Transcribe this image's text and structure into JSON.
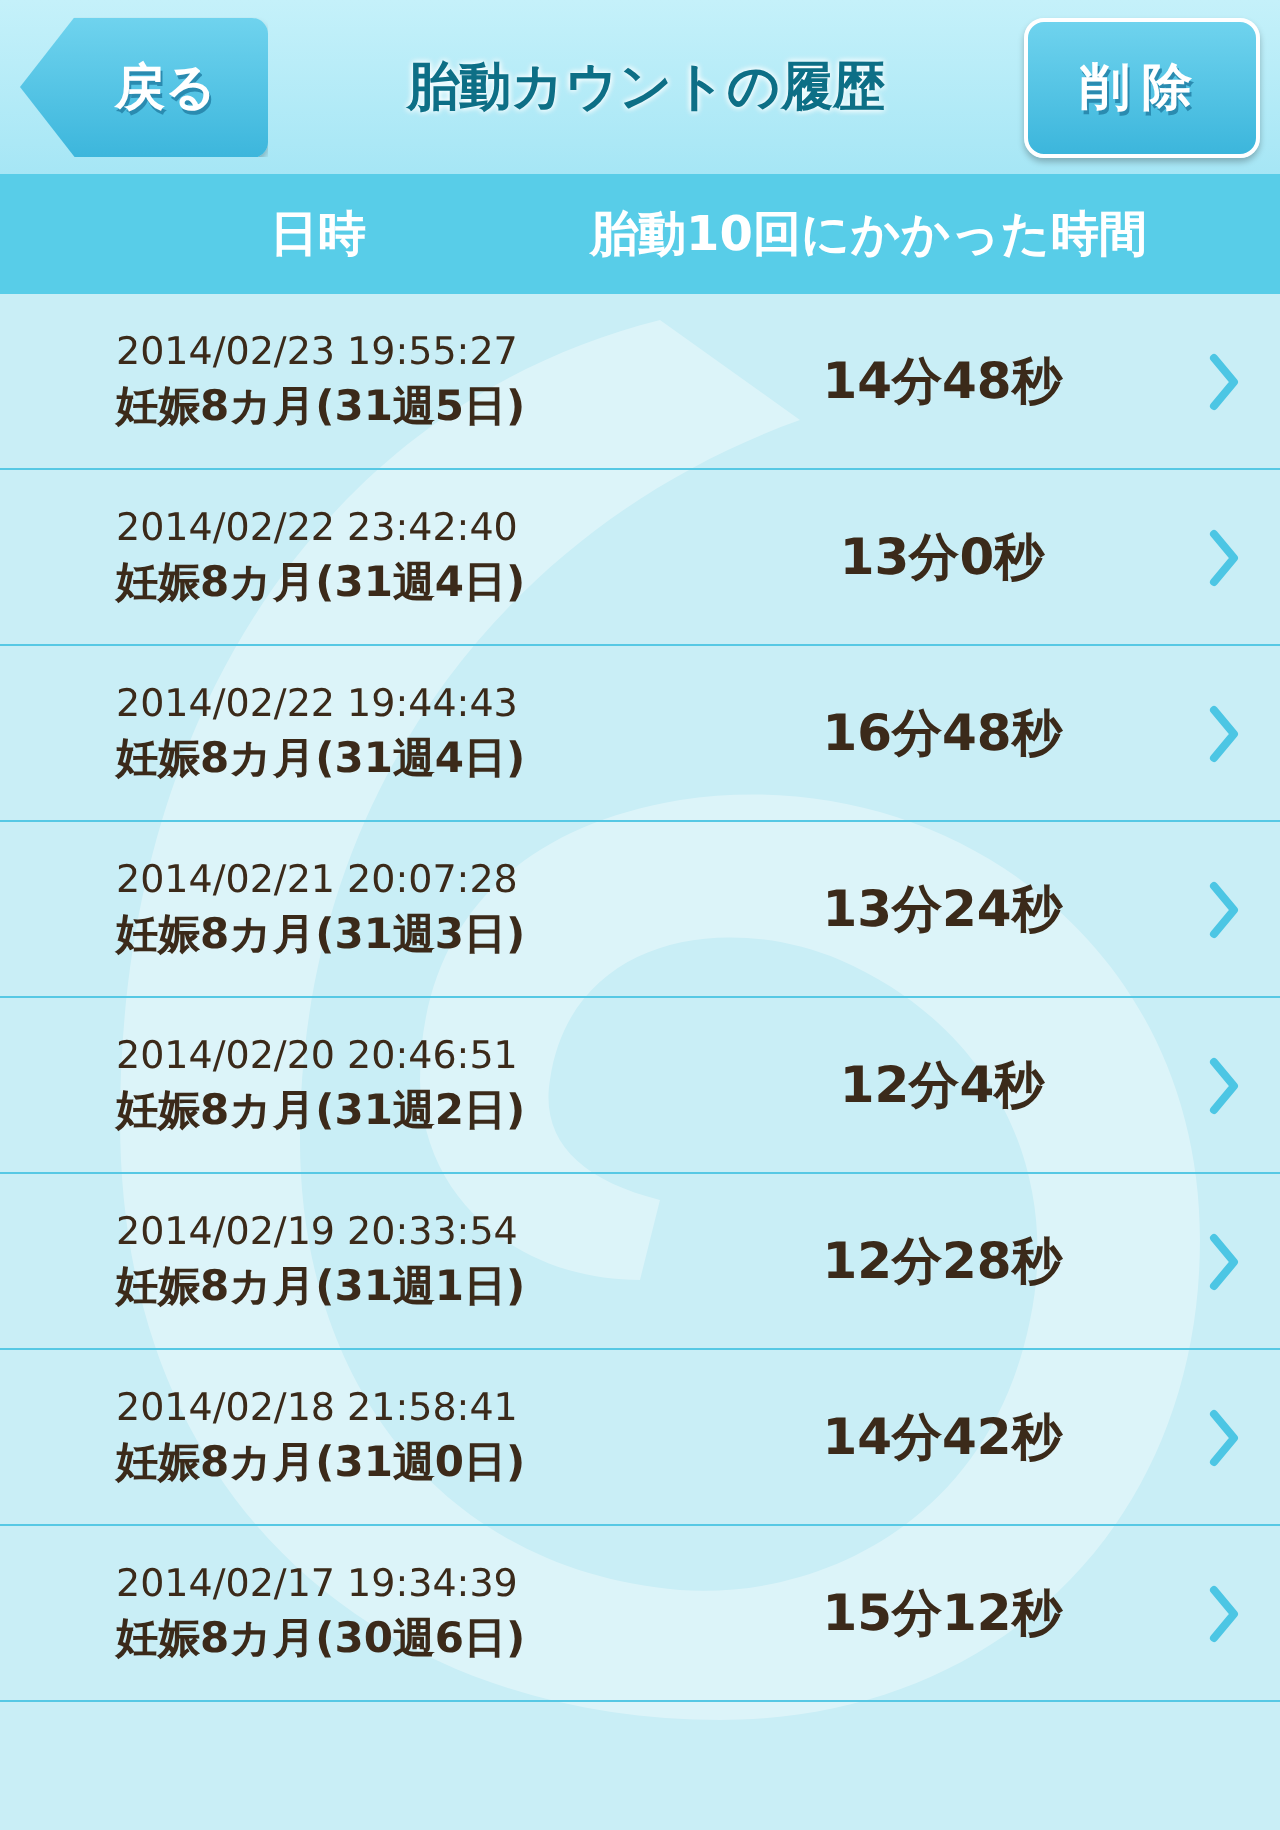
{
  "nav": {
    "back": "戻る",
    "title": "胎動カウントの履歴",
    "delete": "削除"
  },
  "columns": [
    "日時",
    "胎動10回にかかった時間"
  ],
  "rows": [
    {
      "datetime": "2014/02/23 19:55:27",
      "week": "妊娠8カ月(31週5日)",
      "duration": "14分48秒"
    },
    {
      "datetime": "2014/02/22 23:42:40",
      "week": "妊娠8カ月(31週4日)",
      "duration": "13分0秒"
    },
    {
      "datetime": "2014/02/22 19:44:43",
      "week": "妊娠8カ月(31週4日)",
      "duration": "16分48秒"
    },
    {
      "datetime": "2014/02/21 20:07:28",
      "week": "妊娠8カ月(31週3日)",
      "duration": "13分24秒"
    },
    {
      "datetime": "2014/02/20 20:46:51",
      "week": "妊娠8カ月(31週2日)",
      "duration": "12分4秒"
    },
    {
      "datetime": "2014/02/19 20:33:54",
      "week": "妊娠8カ月(31週1日)",
      "duration": "12分28秒"
    },
    {
      "datetime": "2014/02/18 21:58:41",
      "week": "妊娠8カ月(31週0日)",
      "duration": "14分42秒"
    },
    {
      "datetime": "2014/02/17 19:34:39",
      "week": "妊娠8カ月(30週6日)",
      "duration": "15分12秒"
    }
  ]
}
